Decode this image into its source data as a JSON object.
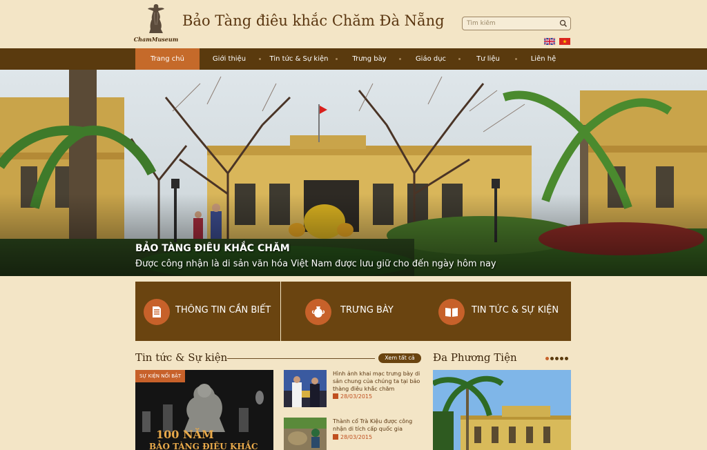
{
  "header": {
    "logo_text": "ChamMuseum",
    "title": "Bảo Tàng điêu khắc Chăm Đà Nẵng",
    "search_placeholder": "Tìm kiếm",
    "flags": [
      "uk-flag-icon",
      "vietnam-flag-icon"
    ]
  },
  "nav": {
    "items": [
      {
        "label": "Trang chủ",
        "active": true
      },
      {
        "label": "Giới thiệu"
      },
      {
        "label": "Tin tức & Sự kiện"
      },
      {
        "label": "Trưng bày"
      },
      {
        "label": "Giáo dục"
      },
      {
        "label": "Tư liệu"
      },
      {
        "label": "Liên hệ"
      }
    ]
  },
  "hero": {
    "title": "BẢO TÀNG ĐIÊU KHẮC CHĂM",
    "subtitle": "Được công nhận là di sản văn hóa Việt Nam được lưu giữ cho đến ngày hôm nay"
  },
  "features": [
    {
      "label": "THÔNG TIN CẦN BIẾT",
      "icon": "document-icon"
    },
    {
      "label": "TRƯNG BÀY",
      "icon": "vase-icon"
    },
    {
      "label": "TIN TỨC & SỰ KIỆN",
      "icon": "book-icon"
    }
  ],
  "news": {
    "title": "Tin tức & Sự kiện",
    "view_all": "Xem tất cả",
    "featured_badge": "SỰ KIỆN NỔI BẬT",
    "featured_big": "100 NĂM",
    "featured_sub": "BẢO TÀNG ĐIÊU KHẮC",
    "items": [
      {
        "title": "Hình ảnh khai mạc trưng bày di sản chung của chúng ta tại bảo thàng điêu khắc chăm",
        "date": "28/03/2015"
      },
      {
        "title": "Thành cổ Trà Kiệu được công nhận di tích cấp quốc gia",
        "date": "28/03/2015"
      }
    ]
  },
  "media": {
    "title": "Đa Phương Tiện"
  },
  "colors": {
    "background": "#f3e5c6",
    "nav": "#5a3a0e",
    "accent": "#c56a2a",
    "feature_box": "#6a4410"
  }
}
